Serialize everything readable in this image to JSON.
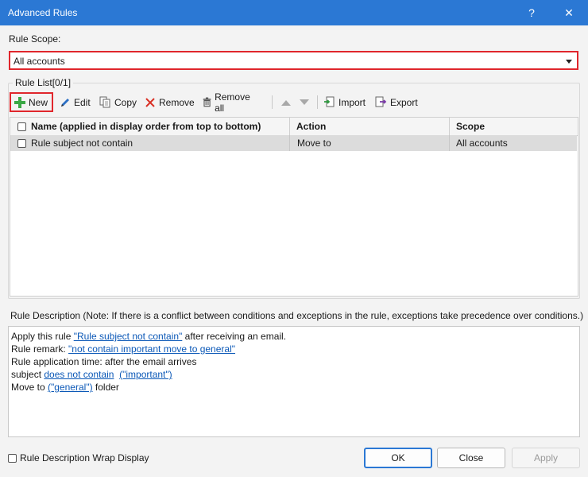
{
  "window": {
    "title": "Advanced Rules",
    "help_glyph": "?",
    "close_glyph": "✕"
  },
  "rule_scope": {
    "label": "Rule Scope:",
    "value": "All accounts"
  },
  "rule_list": {
    "legend": "Rule List[0/1]",
    "toolbar": {
      "new": "New",
      "edit": "Edit",
      "copy": "Copy",
      "remove": "Remove",
      "remove_all": "Remove all",
      "import": "Import",
      "export": "Export"
    },
    "columns": {
      "name": "Name (applied in display order from top to bottom)",
      "action": "Action",
      "scope": "Scope"
    },
    "rows": [
      {
        "name": "Rule subject not contain",
        "action": "Move to",
        "scope": "All accounts"
      }
    ]
  },
  "description": {
    "label": "Rule Description (Note: If there is a conflict between conditions and exceptions in the rule, exceptions take precedence over conditions.)",
    "line1_prefix": "Apply this rule ",
    "line1_link": "\"Rule subject not contain\"",
    "line1_suffix": " after receiving an email.",
    "line2_prefix": "Rule remark: ",
    "line2_link": "\"not contain important move to general\"",
    "line3": "Rule application time: after the email arrives",
    "line4_prefix": "subject ",
    "line4_link1": "does not contain",
    "line4_link2": "(\"important\")",
    "line5_prefix": "Move to ",
    "line5_link": "(\"general\")",
    "line5_suffix": " folder"
  },
  "footer": {
    "wrap_label": "Rule Description Wrap Display",
    "ok": "OK",
    "close": "Close",
    "apply": "Apply"
  },
  "colors": {
    "titlebar": "#2b78d4",
    "highlight": "#e0262c",
    "link": "#0b58b7"
  }
}
